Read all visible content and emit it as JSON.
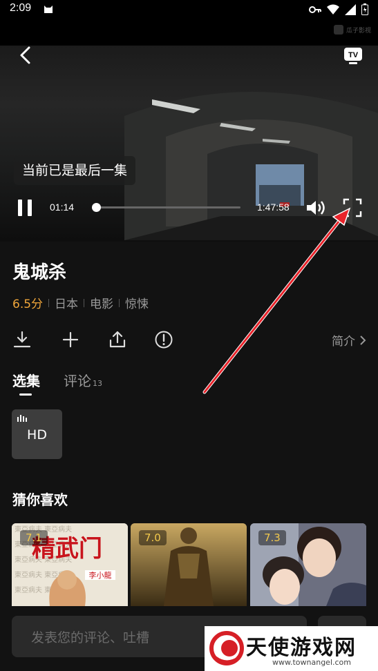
{
  "status_bar": {
    "time": "2:09"
  },
  "player": {
    "watermark": "瓜子影视",
    "toast": "当前已是最后一集",
    "current_time": "01:14",
    "duration": "1:47:58",
    "progress": 0.011,
    "tv_label": "TV"
  },
  "movie": {
    "title": "鬼城杀",
    "score": "6.5分",
    "tags": [
      "日本",
      "电影",
      "惊悚"
    ]
  },
  "actions": {
    "intro_label": "简介"
  },
  "tabs": [
    {
      "label": "选集",
      "count": ""
    },
    {
      "label": "评论",
      "count": "13"
    }
  ],
  "episodes": [
    {
      "label": "HD"
    }
  ],
  "recommend": {
    "title": "猜你喜欢",
    "items": [
      {
        "rating": "7.1",
        "poster_text": "精武门",
        "poster_sub": "李小龍"
      },
      {
        "rating": "7.0"
      },
      {
        "rating": "7.3"
      }
    ]
  },
  "comment": {
    "placeholder": "发表您的评论、吐槽"
  },
  "site_watermark": {
    "name": "天使游戏网",
    "url": "www.townangel.com"
  },
  "colors": {
    "score": "#f0a63a",
    "rating": "#f2c94c",
    "annotation_arrow": "#e8232a"
  }
}
